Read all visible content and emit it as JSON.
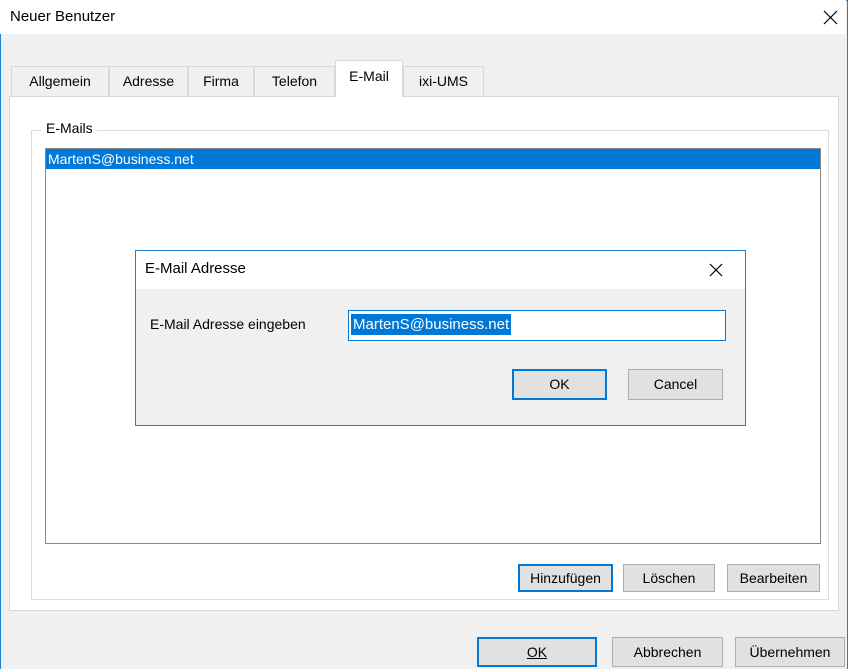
{
  "window": {
    "title": "Neuer Benutzer"
  },
  "tabs": [
    {
      "label": "Allgemein"
    },
    {
      "label": "Adresse"
    },
    {
      "label": "Firma"
    },
    {
      "label": "Telefon"
    },
    {
      "label": "E-Mail",
      "active": true
    },
    {
      "label": "ixi-UMS"
    }
  ],
  "emails": {
    "group_label": "E-Mails",
    "items": [
      {
        "address": "MartenS@business.net",
        "selected": true
      }
    ],
    "buttons": {
      "add": "Hinzufügen",
      "delete": "Löschen",
      "edit": "Bearbeiten"
    }
  },
  "footer": {
    "ok": "OK",
    "cancel": "Abbrechen",
    "apply": "Übernehmen"
  },
  "dialog": {
    "title": "E-Mail Adresse",
    "label": "E-Mail Adresse eingeben",
    "input_value": "MartenS@business.net",
    "ok": "OK",
    "cancel": "Cancel"
  },
  "colors": {
    "accent": "#0078d7",
    "selection": "#0078d7",
    "window_bg": "#f0f0f0",
    "panel_bg": "#ffffff"
  },
  "icons": {
    "close": "close-icon"
  }
}
